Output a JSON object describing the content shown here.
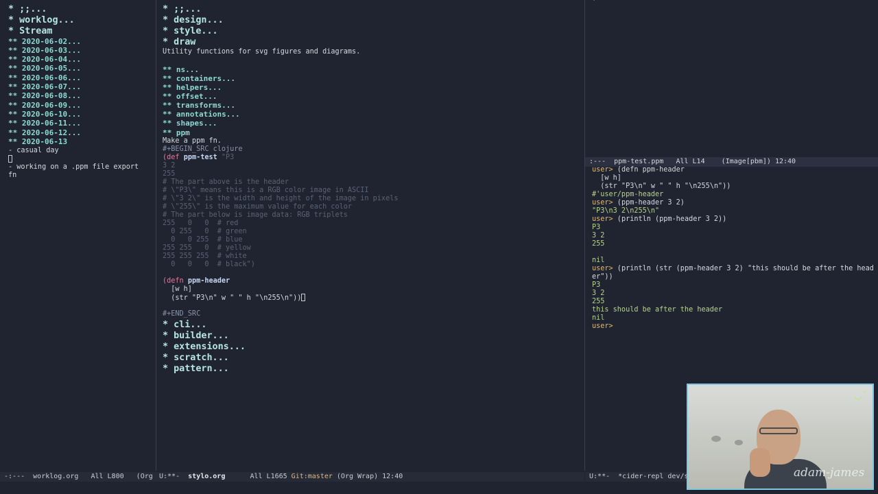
{
  "left": {
    "lines": [
      "* ;;...",
      "* worklog...",
      "* Stream",
      "** 2020-06-02...",
      "** 2020-06-03...",
      "** 2020-06-04...",
      "** 2020-06-05...",
      "** 2020-06-06...",
      "** 2020-06-07...",
      "** 2020-06-08...",
      "** 2020-06-09...",
      "** 2020-06-10...",
      "** 2020-06-11...",
      "** 2020-06-12...",
      "** 2020-06-13",
      "- casual day",
      "",
      "- working on a .ppm file export",
      "fn"
    ]
  },
  "middle": {
    "h1_top": [
      "* ;;...",
      "* design...",
      "* style...",
      "* draw"
    ],
    "description": "Utility functions for svg figures and diagrams.",
    "h2": [
      "** ns...",
      "** containers...",
      "** helpers...",
      "** offset...",
      "** transforms...",
      "** annotations...",
      "** shapes...",
      "** ppm"
    ],
    "make": "Make a ppm fn.",
    "begin_src": "#+BEGIN_SRC clojure",
    "def_kw": "(def",
    "def_name": "ppm-test",
    "def_str": "\"P3",
    "code_lines": [
      "3 2",
      "255",
      "# The part above is the header",
      "# \\\"P3\\\" means this is a RGB color image in ASCII",
      "# \\\"3 2\\\" is the width and height of the image in pixels",
      "# \\\"255\\\" is the maximum value for each color",
      "# The part below is image data: RGB triplets",
      "255   0   0  # red",
      "  0 255   0  # green",
      "  0   0 255  # blue",
      "255 255   0  # yellow",
      "255 255 255  # white",
      "  0   0   0  # black\")"
    ],
    "defn_kw": "(defn",
    "defn_name": "ppm-header",
    "defn_args": "  [w h]",
    "defn_body": "  (str \"P3\\n\" w \" \" h \"\\n255\\n\"))",
    "end_src": "#+END_SRC",
    "h1_bottom": [
      "* cli...",
      "* builder...",
      "* extensions...",
      "* scratch...",
      "* pattern..."
    ]
  },
  "right": {
    "ppm_status": " :---  ppm-test.ppm   All L14    (Image[pbm]) 12:40",
    "repl_lines": [
      "user> (defn ppm-header",
      "  [w h]",
      "  (str \"P3\\n\" w \" \" h \"\\n255\\n\"))",
      "#'user/ppm-header",
      "user> (ppm-header 3 2)",
      "\"P3\\n3 2\\n255\\n\"",
      "user> (println (ppm-header 3 2))",
      "P3",
      "3 2",
      "255",
      "",
      "nil",
      "user> (println (str (ppm-header 3 2) \"this should be after the head",
      "er\"))",
      "P3",
      "3 2",
      "255",
      "this should be after the header",
      "nil",
      "user>"
    ]
  },
  "modelines": {
    "left": " -:---  worklog.org   All L800   (Org",
    "middle_a": "U:**-  ",
    "middle_file": "stylo.org",
    "middle_b": "      All L1665 ",
    "middle_git": "Git:master",
    "middle_c": " (Org Wrap) 12:40",
    "right": " U:**-  *cider-repl dev/s"
  },
  "webcam": {
    "watermark": "adam-james"
  }
}
